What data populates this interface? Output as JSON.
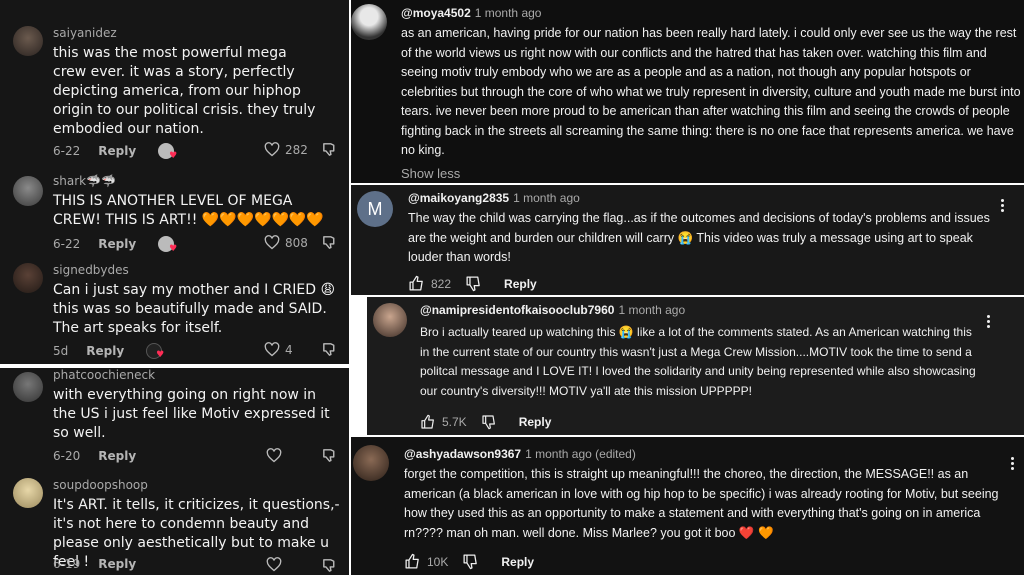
{
  "tiktok": {
    "comments": [
      {
        "username": "saiyanidez",
        "text": "this was the most powerful mega crew ever. it was a story, perfectly depicting america, from our hiphop origin to our political crisis. they truly embodied our nation.",
        "date": "6-22",
        "reply": "Reply",
        "likes": "282"
      },
      {
        "username": "shark🦈🦈",
        "text": "THIS IS ANOTHER LEVEL OF MEGA CREW! THIS IS ART!! 🧡🧡🧡🧡🧡🧡🧡",
        "date": "6-22",
        "reply": "Reply",
        "likes": "808"
      },
      {
        "username": "signedbydes",
        "text": "Can i just say my mother and I CRIED 😩 this was so beautifully made and SAID. The art speaks for itself.",
        "date": "5d",
        "reply": "Reply",
        "likes": "4"
      },
      {
        "username": "phatcoochieneck",
        "text": "with everything going on right now in the US i just feel like Motiv expressed it so well.",
        "date": "6-20",
        "reply": "Reply",
        "likes": ""
      },
      {
        "username": "soupdoopshoop",
        "text": "It's ART. it tells, it criticizes, it questions,- it's not here to condemn beauty and please only aesthetically but to make u feel !",
        "date": "6-19",
        "reply": "Reply",
        "likes": ""
      }
    ]
  },
  "youtube": {
    "comments": [
      {
        "handle": "@moya4502",
        "time": "1 month ago",
        "text": "as an american, having pride for our nation has been really hard lately. i could only ever see us the way the rest of the world views us right now with our conflicts and the hatred that has taken over. watching this film and seeing motiv truly embody who we are as a people and as a nation, not though any popular hotspots or celebrities but through the core of who what we truly represent in diversity, culture and youth made me burst into tears. ive never been more proud to be american than after watching this film and seeing the crowds of people fighting back in the streets all screaming the same thing: there is no one face that represents america. we have no king.",
        "show_less": "Show less"
      },
      {
        "handle": "@maikoyang2835",
        "time": "1 month ago",
        "avatar_letter": "M",
        "text": "The way the child was carrying the flag...as if the outcomes and decisions of today's problems and issues are the weight and burden our children will carry 😭 This video was truly a message using art to speak louder than words!",
        "likes": "822",
        "reply": "Reply"
      },
      {
        "handle": "@namipresidentofkaisooclub7960",
        "time": "1 month ago",
        "text": "Bro i actually teared up watching this 😭 like a lot of the comments stated. As an American watching this in the current state of our country this wasn't just a Mega Crew Mission....MOTIV took the time to send a politcal message and I LOVE IT! I loved the solidarity and unity being represented while also showcasing our country's diversity!!! MOTIV ya'll ate this mission UPPPPP!",
        "likes": "5.7K",
        "reply": "Reply"
      },
      {
        "handle": "@ashyadawson9367",
        "time": "1 month ago (edited)",
        "text": "forget the competition, this is straight up meaningful!!! the choreo, the direction, the MESSAGE!! as an american (a black american in love with og hip hop to be specific) i was already rooting for Motiv, but seeing how they used this as an opportunity to make a statement and with everything that's going on in america rn???? man oh man. well done. Miss Marlee? you got it boo ❤️ 🧡",
        "likes": "10K",
        "reply": "Reply"
      }
    ]
  }
}
